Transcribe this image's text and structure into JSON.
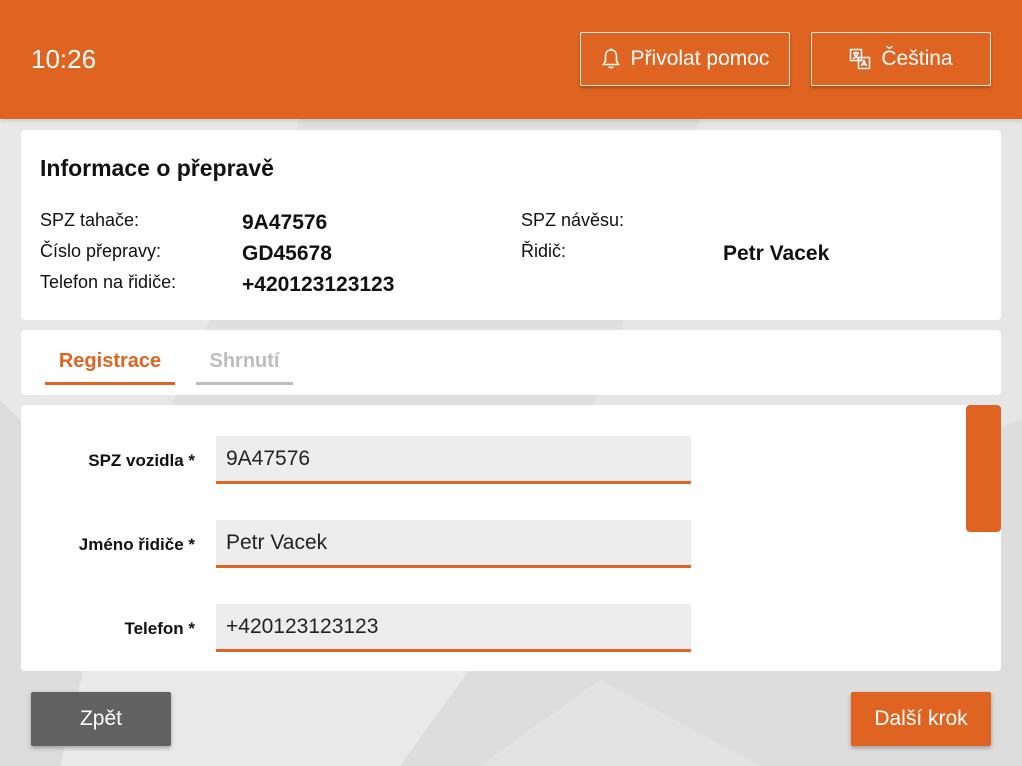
{
  "header": {
    "time": "10:26",
    "help_button": "Přivolat pomoc",
    "language_button": "Čeština",
    "accent_color": "#df6421"
  },
  "info": {
    "title": "Informace o přepravě",
    "fields": {
      "tractor_plate_label": "SPZ tahače:",
      "tractor_plate_value": "9A47576",
      "trailer_plate_label": "SPZ návěsu:",
      "trailer_plate_value": "",
      "transport_number_label": "Číslo přepravy:",
      "transport_number_value": "GD45678",
      "driver_label": "Řidič:",
      "driver_value": "Petr Vacek",
      "driver_phone_label": "Telefon na řidiče:",
      "driver_phone_value": "+420123123123"
    }
  },
  "tabs": {
    "registration": "Registrace",
    "summary": "Shrnutí"
  },
  "form": {
    "vehicle_plate_label": "SPZ vozidla *",
    "vehicle_plate_value": "9A47576",
    "driver_name_label": "Jméno řidiče *",
    "driver_name_value": "Petr Vacek",
    "phone_label": "Telefon *",
    "phone_value": "+420123123123"
  },
  "footer": {
    "back_button": "Zpět",
    "next_button": "Další krok"
  },
  "icons": {
    "help": "bell-icon",
    "language": "translate-icon"
  }
}
